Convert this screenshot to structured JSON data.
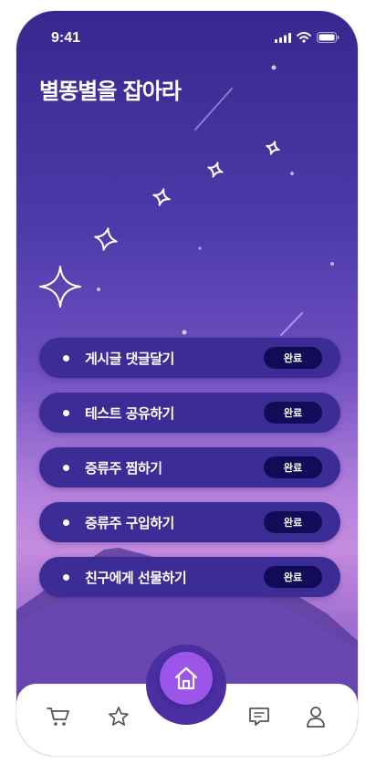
{
  "status_bar": {
    "time": "9:41"
  },
  "title": "별똥별을 잡아라",
  "missions": [
    {
      "label": "게시글 댓글달기",
      "status": "완료"
    },
    {
      "label": "테스트 공유하기",
      "status": "완료"
    },
    {
      "label": "증류주 찜하기",
      "status": "완료"
    },
    {
      "label": "증류주 구입하기",
      "status": "완료"
    },
    {
      "label": "친구에게 선물하기",
      "status": "완료"
    }
  ],
  "bottom_nav": {
    "items": [
      "cart-icon",
      "star-icon",
      "home-icon",
      "chat-icon",
      "user-icon"
    ],
    "active": "home-icon"
  },
  "colors": {
    "accent": "#9b55e8",
    "mission_bg": "#3b2c96",
    "status_bg": "#120c58",
    "sky_top": "#36288e"
  }
}
